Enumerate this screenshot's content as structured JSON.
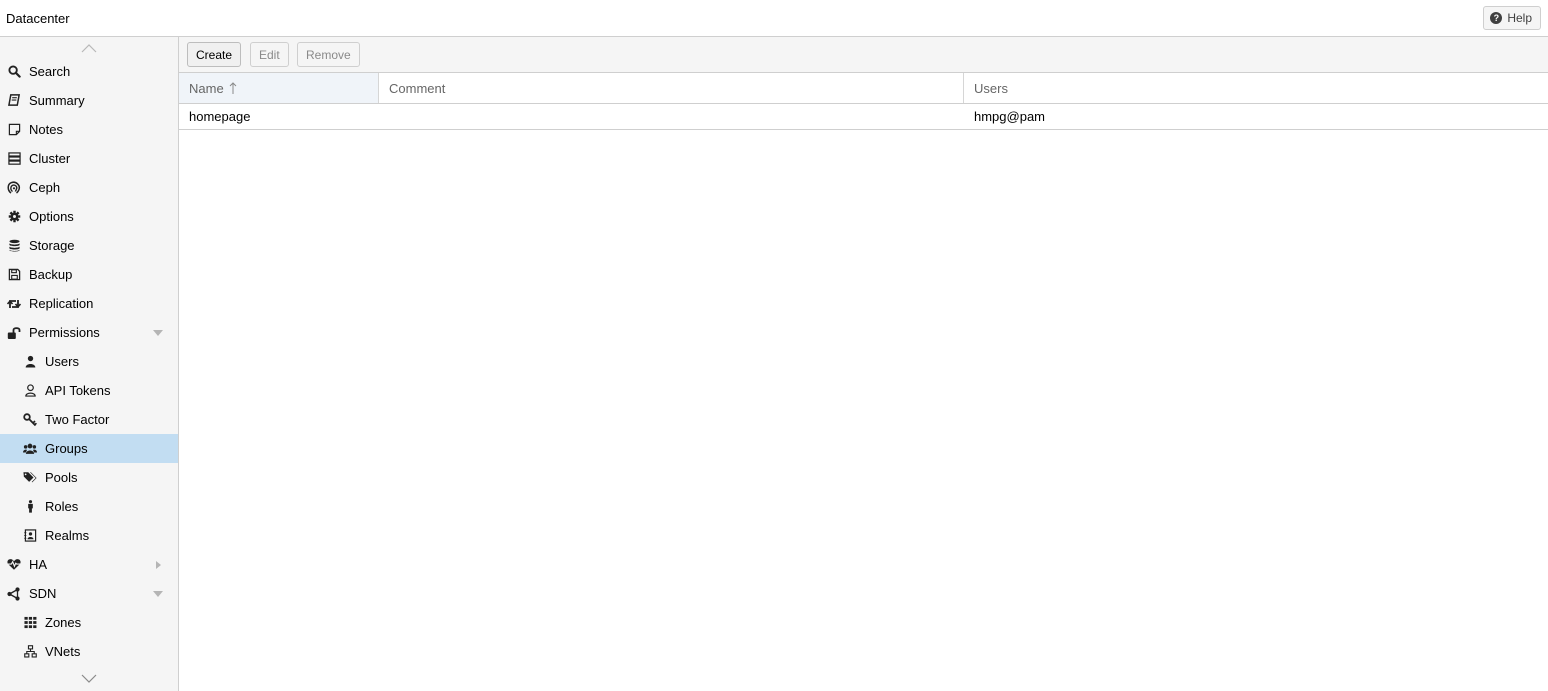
{
  "header": {
    "title": "Datacenter",
    "help_label": "Help"
  },
  "sidebar": {
    "items": [
      {
        "label": "Search",
        "icon": "search-icon",
        "level": 0
      },
      {
        "label": "Summary",
        "icon": "book-icon",
        "level": 0
      },
      {
        "label": "Notes",
        "icon": "sticky-note-icon",
        "level": 0
      },
      {
        "label": "Cluster",
        "icon": "server-icon",
        "level": 0
      },
      {
        "label": "Ceph",
        "icon": "ceph-icon",
        "level": 0
      },
      {
        "label": "Options",
        "icon": "gear-icon",
        "level": 0
      },
      {
        "label": "Storage",
        "icon": "database-icon",
        "level": 0
      },
      {
        "label": "Backup",
        "icon": "floppy-icon",
        "level": 0
      },
      {
        "label": "Replication",
        "icon": "retweet-icon",
        "level": 0
      },
      {
        "label": "Permissions",
        "icon": "unlock-icon",
        "level": 0,
        "expander": "down"
      },
      {
        "label": "Users",
        "icon": "user-icon",
        "level": 1
      },
      {
        "label": "API Tokens",
        "icon": "user-outline-icon",
        "level": 1
      },
      {
        "label": "Two Factor",
        "icon": "key-icon",
        "level": 1
      },
      {
        "label": "Groups",
        "icon": "users-icon",
        "level": 1,
        "selected": true
      },
      {
        "label": "Pools",
        "icon": "tags-icon",
        "level": 1
      },
      {
        "label": "Roles",
        "icon": "male-icon",
        "level": 1
      },
      {
        "label": "Realms",
        "icon": "address-book-icon",
        "level": 1
      },
      {
        "label": "HA",
        "icon": "heartbeat-icon",
        "level": 0,
        "expander": "right"
      },
      {
        "label": "SDN",
        "icon": "sdn-icon",
        "level": 0,
        "expander": "down"
      },
      {
        "label": "Zones",
        "icon": "th-icon",
        "level": 1
      },
      {
        "label": "VNets",
        "icon": "sitemap-icon",
        "level": 1
      }
    ]
  },
  "toolbar": {
    "create_label": "Create",
    "edit_label": "Edit",
    "remove_label": "Remove"
  },
  "grid": {
    "columns": [
      {
        "label": "Name",
        "sorted": "asc"
      },
      {
        "label": "Comment"
      },
      {
        "label": "Users"
      }
    ],
    "rows": [
      {
        "name": "homepage",
        "comment": "",
        "users": "hmpg@pam"
      }
    ]
  },
  "colors": {
    "selected_row": "#c2ddf2",
    "sidebar_bg": "#f5f5f5",
    "border": "#cfcfcf"
  }
}
